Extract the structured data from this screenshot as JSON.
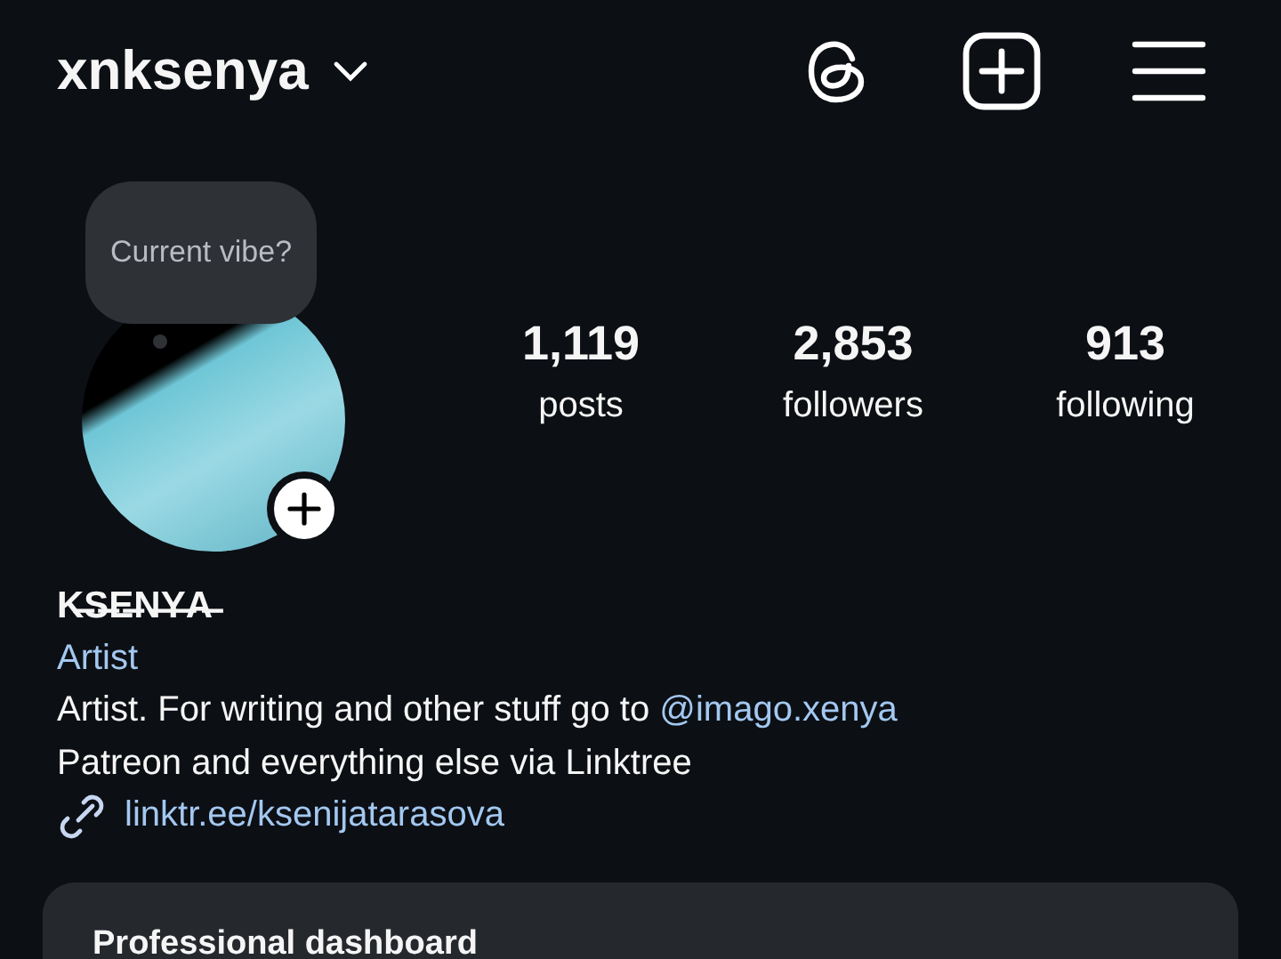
{
  "header": {
    "username": "xnksenya"
  },
  "note": {
    "text": "Current vibe?"
  },
  "stats": [
    {
      "value": "1,119",
      "label": "posts"
    },
    {
      "value": "2,853",
      "label": "followers"
    },
    {
      "value": "913",
      "label": "following"
    }
  ],
  "bio": {
    "name": "K̶S̶E̶N̶Y̶A̶",
    "category": "Artist",
    "text": "Artist. For writing and other stuff go to ",
    "mention": "@imago.xenya",
    "line2": "Patreon and everything else via Linktree",
    "link": "linktr.ee/ksenijatarasova"
  },
  "dashboard": {
    "title": "Professional dashboard"
  }
}
